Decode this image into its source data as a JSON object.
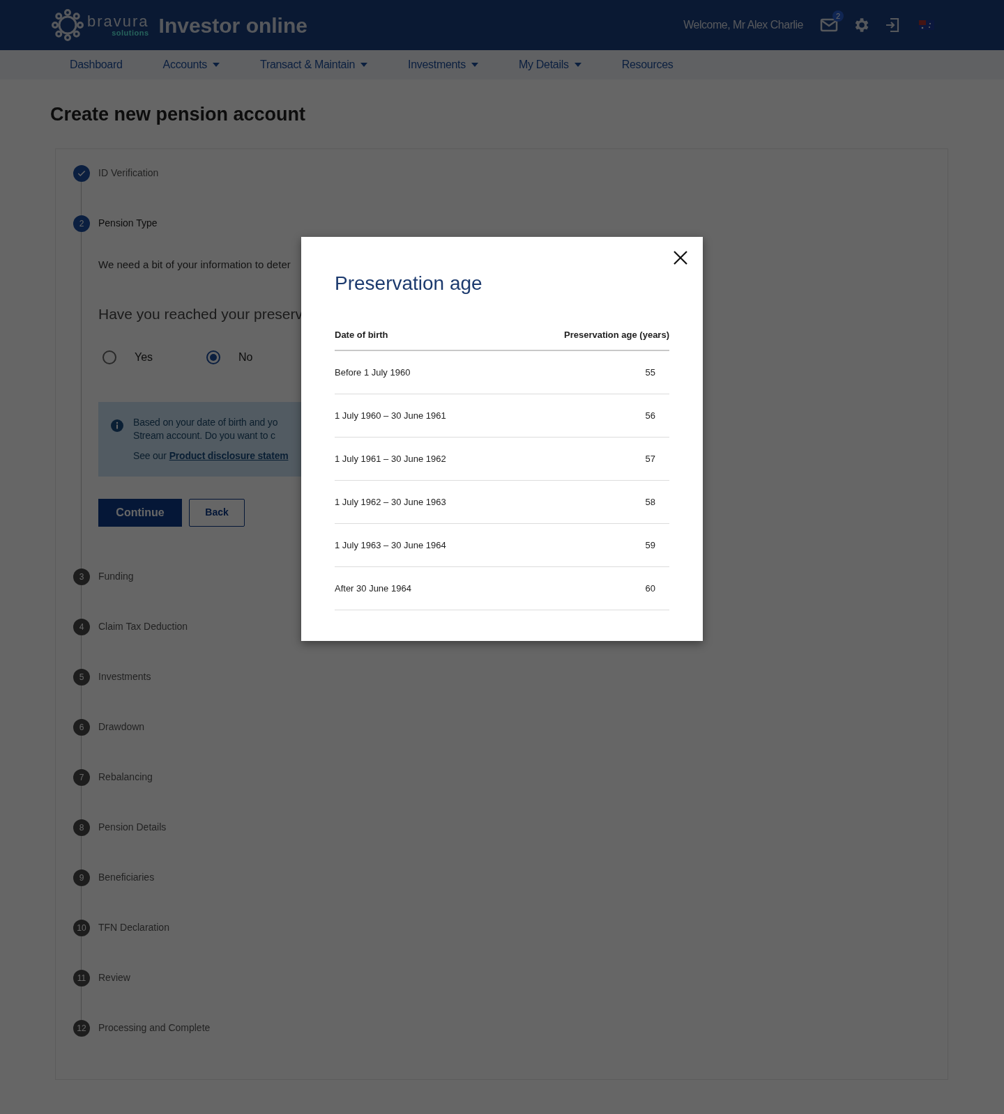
{
  "header": {
    "logo_name": "bravura",
    "logo_sub": "solutions",
    "app_title": "Investor online",
    "welcome": "Welcome, Mr Alex Charlie",
    "mail_badge": "2"
  },
  "nav": [
    {
      "label": "Dashboard",
      "dropdown": false
    },
    {
      "label": "Accounts",
      "dropdown": true
    },
    {
      "label": "Transact & Maintain",
      "dropdown": true
    },
    {
      "label": "Investments",
      "dropdown": true
    },
    {
      "label": "My Details",
      "dropdown": true
    },
    {
      "label": "Resources",
      "dropdown": false
    }
  ],
  "page_title": "Create new pension account",
  "steps": [
    {
      "label": "ID Verification",
      "done": true,
      "selected": false
    },
    {
      "number": "2",
      "label": "Pension Type",
      "done": false,
      "selected": true
    },
    {
      "number": "3",
      "label": "Funding",
      "done": false,
      "selected": false
    },
    {
      "number": "4",
      "label": "Claim Tax Deduction",
      "done": false,
      "selected": false
    },
    {
      "number": "5",
      "label": "Investments",
      "done": false,
      "selected": false
    },
    {
      "number": "6",
      "label": "Drawdown",
      "done": false,
      "selected": false
    },
    {
      "number": "7",
      "label": "Rebalancing",
      "done": false,
      "selected": false
    },
    {
      "number": "8",
      "label": "Pension Details",
      "done": false,
      "selected": false
    },
    {
      "number": "9",
      "label": "Beneficiaries",
      "done": false,
      "selected": false
    },
    {
      "number": "10",
      "label": "TFN Declaration",
      "done": false,
      "selected": false
    },
    {
      "number": "11",
      "label": "Review",
      "done": false,
      "selected": false
    },
    {
      "number": "12",
      "label": "Processing and Complete",
      "done": false,
      "selected": false
    }
  ],
  "pension_form": {
    "intro": "We need a bit of your information to deter",
    "question": "Have you reached your preserv",
    "options": [
      {
        "label": "Yes",
        "selected": false
      },
      {
        "label": "No",
        "selected": true
      }
    ],
    "info": {
      "lines": [
        "Based on your date of birth and yo",
        "Stream account. Do you want to c"
      ],
      "see_prefix": "See our",
      "link": "Product disclosure statem"
    },
    "buttons": [
      {
        "label": "Continue",
        "kind": "primary"
      },
      {
        "label": "Back",
        "kind": "secondary"
      }
    ]
  },
  "modal": {
    "title": "Preservation age",
    "columns": [
      "Date of birth",
      "Preservation age (years)"
    ],
    "rows": [
      {
        "dob": "Before 1 July 1960",
        "age": "55"
      },
      {
        "dob": "1 July 1960 – 30 June 1961",
        "age": "56"
      },
      {
        "dob": "1 July 1961 – 30 June 1962",
        "age": "57"
      },
      {
        "dob": "1 July 1962 – 30 June 1963",
        "age": "58"
      },
      {
        "dob": "1 July 1963 – 30 June 1964",
        "age": "59"
      },
      {
        "dob": "After 30 June 1964",
        "age": "60"
      }
    ]
  }
}
